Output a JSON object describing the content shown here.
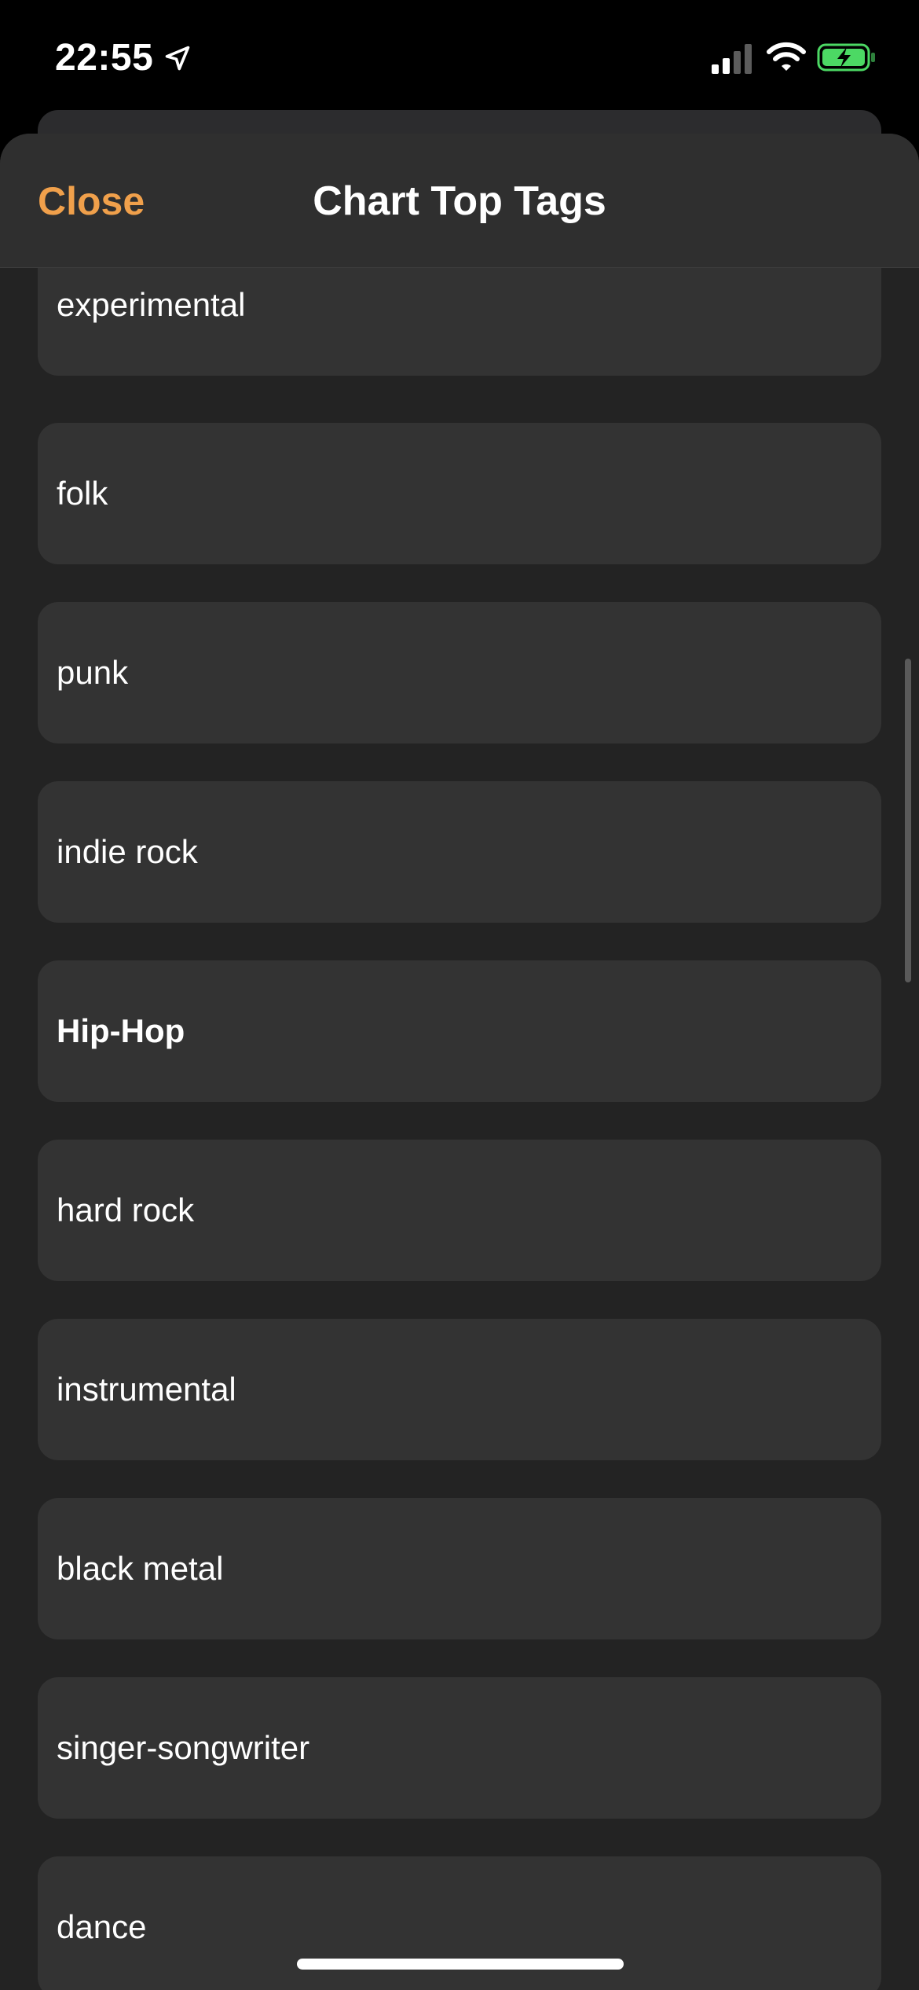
{
  "status_bar": {
    "time": "22:55",
    "icons": [
      "location-arrow-icon",
      "cellular-signal-icon",
      "wifi-icon",
      "battery-charging-icon"
    ],
    "battery_color": "#4cd964"
  },
  "nav": {
    "close_label": "Close",
    "title": "Chart Top Tags",
    "accent_color": "#f0a04b"
  },
  "tags": [
    {
      "label": "experimental"
    },
    {
      "label": "folk"
    },
    {
      "label": "punk"
    },
    {
      "label": "indie rock"
    },
    {
      "label": "Hip-Hop"
    },
    {
      "label": "hard rock"
    },
    {
      "label": "instrumental"
    },
    {
      "label": "black metal"
    },
    {
      "label": "singer-songwriter"
    },
    {
      "label": "dance"
    }
  ]
}
